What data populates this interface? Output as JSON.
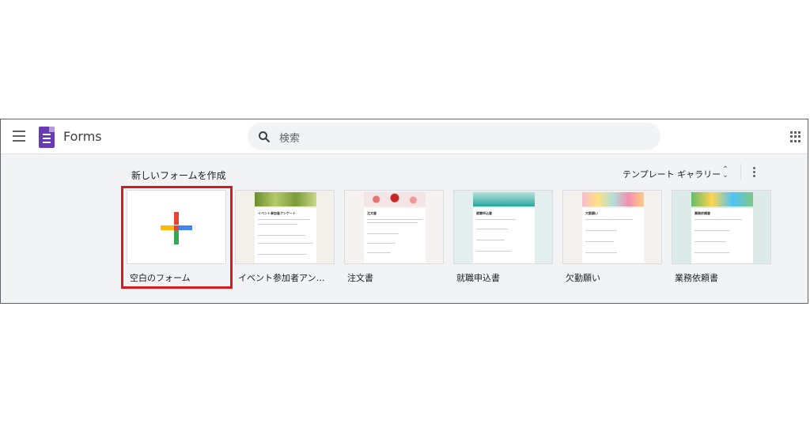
{
  "app": {
    "title": "Forms",
    "search_placeholder": "検索",
    "colors": {
      "brand": "#673ab7",
      "highlight": "#d71921",
      "plus": [
        "#4285f4",
        "#ea4335",
        "#fbbc04",
        "#34a853"
      ]
    }
  },
  "section": {
    "heading": "新しいフォームを作成",
    "gallery_label": "テンプレート ギャラリー"
  },
  "templates": [
    {
      "label": "空白のフォーム"
    },
    {
      "label": "イベント参加者アンケート",
      "thumb_title": "イベント参加者アンケート"
    },
    {
      "label": "注文書",
      "thumb_title": "注文書"
    },
    {
      "label": "就職申込書",
      "thumb_title": "就職申込書"
    },
    {
      "label": "欠勤願い",
      "thumb_title": "欠勤願い"
    },
    {
      "label": "業務依頼書",
      "thumb_title": "業務依頼書"
    }
  ],
  "icons": [
    "menu-icon",
    "forms-logo-icon",
    "search-icon",
    "apps-grid-icon",
    "sort-icon",
    "more-vert-icon",
    "plus-icon"
  ]
}
